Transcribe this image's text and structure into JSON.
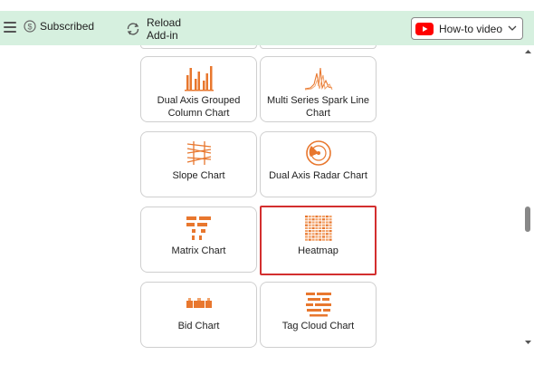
{
  "toolbar": {
    "subscribed_label": "Subscribed",
    "reload_label": "Reload Add-in",
    "howto_label": "How-to video"
  },
  "colors": {
    "toolbar_bg": "#d6f0df",
    "icon_orange": "#e8772e",
    "selected_border": "#d32f2f",
    "youtube_red": "#ff0000"
  },
  "charts": [
    {
      "label": "Dual Axis Grouped Column Chart",
      "icon": "grouped-column-icon",
      "selected": false
    },
    {
      "label": "Multi Series Spark Line Chart",
      "icon": "spark-line-icon",
      "selected": false
    },
    {
      "label": "Slope Chart",
      "icon": "slope-chart-icon",
      "selected": false
    },
    {
      "label": "Dual Axis Radar Chart",
      "icon": "radar-chart-icon",
      "selected": false
    },
    {
      "label": "Matrix Chart",
      "icon": "matrix-chart-icon",
      "selected": false
    },
    {
      "label": "Heatmap",
      "icon": "heatmap-icon",
      "selected": true
    },
    {
      "label": "Bid Chart",
      "icon": "bid-chart-icon",
      "selected": false
    },
    {
      "label": "Tag Cloud Chart",
      "icon": "tag-cloud-icon",
      "selected": false
    }
  ]
}
